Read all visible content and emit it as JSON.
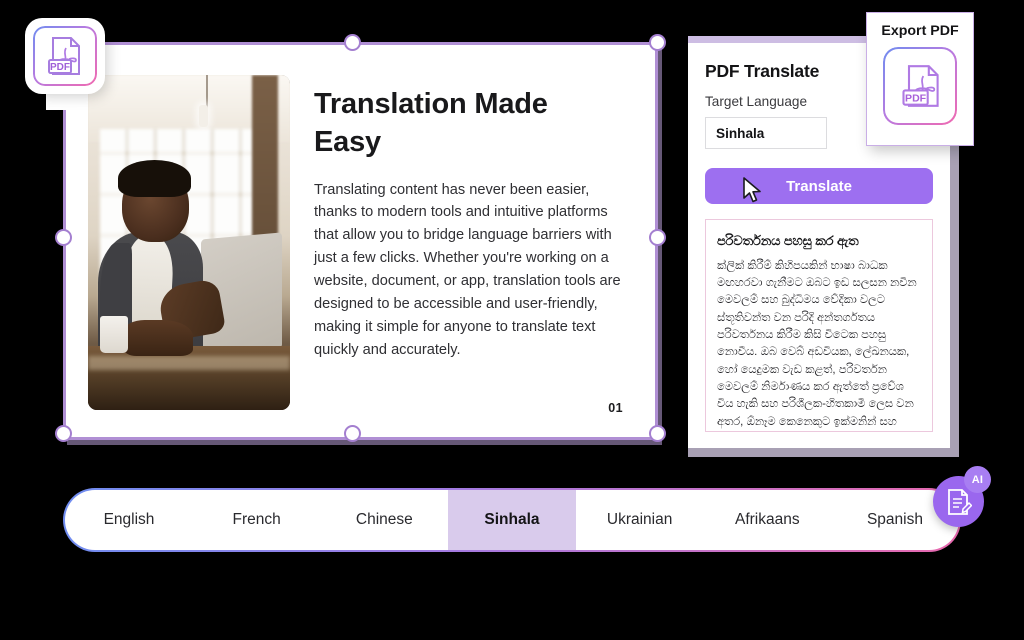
{
  "document_card": {
    "title": "Translation Made Easy",
    "body": "Translating content has never been easier, thanks to modern tools and intuitive platforms that allow you to bridge language barriers with just a few clicks. Whether you're working on a website, document, or app, translation tools are designed to be accessible and user-friendly, making it simple for anyone to translate text quickly and accurately.",
    "page_number": "01",
    "photo_alt": "man working on a laptop at a sunlit desk",
    "badge_icon": "pdf-file-icon"
  },
  "panel": {
    "title": "PDF Translate",
    "target_language_label": "Target Language",
    "selected_language": "Sinhala",
    "translate_button": "Translate",
    "cursor_icon": "mouse-pointer-icon",
    "result": {
      "title": "පරිවර්තනය පහසු කර ඇත",
      "body": "ක්ලික් කිරීම් කිහිපයකින් භාෂා බාධක මඟහරවා ගැනීමට ඔබට ඉඩ සලසන නවීන මෙවලම් සහ බුද්ධිමය වේදිකා වලට ස්තූතිවන්ත වන පරිදි අන්තර්ගතය පරිවර්තනය කිරීම කිසි විටෙක පහසු නොවීය. ඔබ වෙබ් අඩවියක, ලේඛනයක, හෝ යෙදුමක වැඩ කළත්, පරිවර්තන මෙවලම් නිර්මාණය කර ඇත්තේ ප්‍රවේශ විය හැකි සහ පරිශීලක-හිතකාමී ලෙස වන අතර, ඕනෑම කෙනෙකුට ඉක්මනින් සහ නිවැරදිව පෙළ පරිවර්තනය කිරීම පහසු කරයි."
    }
  },
  "export_card": {
    "label": "Export PDF",
    "icon": "pdf-file-icon",
    "icon_text": "PDF"
  },
  "tabbar": {
    "tabs": [
      {
        "label": "English",
        "active": false
      },
      {
        "label": "French",
        "active": false
      },
      {
        "label": "Chinese",
        "active": false
      },
      {
        "label": "Sinhala",
        "active": true
      },
      {
        "label": "Ukrainian",
        "active": false
      },
      {
        "label": "Afrikaans",
        "active": false
      },
      {
        "label": "Spanish",
        "active": false
      }
    ]
  },
  "ai_fab": {
    "badge": "AI",
    "icon": "document-edit-icon"
  },
  "colors": {
    "accent_purple": "#9d6ff0",
    "tab_active_bg": "#d9cbec",
    "card_border": "#b08fd4",
    "panel_top_strip": "#cdbde3",
    "gradient_start": "#6f8df0",
    "gradient_mid": "#b87ae0",
    "gradient_end": "#f06ab0",
    "background": "#000000"
  }
}
